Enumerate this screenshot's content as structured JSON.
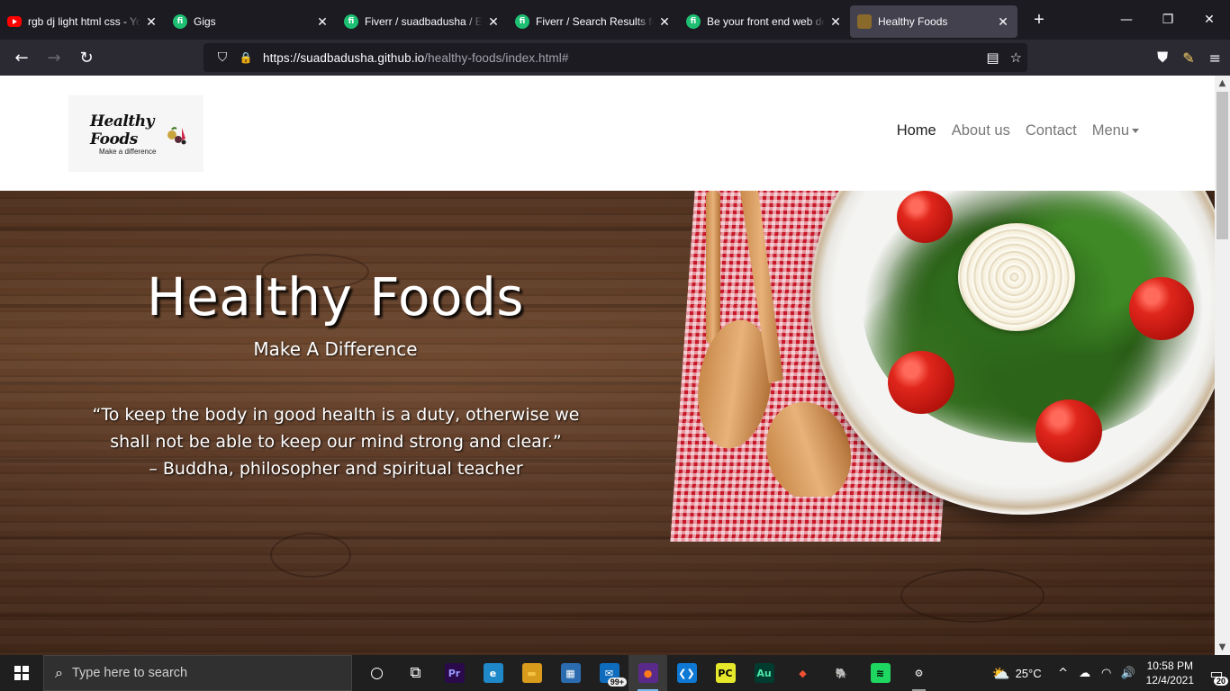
{
  "browser": {
    "tabs": [
      {
        "title": "rgb dj light html css - YouTube",
        "icon": "youtube-icon",
        "close": "✕"
      },
      {
        "title": "Gigs",
        "icon": "fiverr-icon",
        "close": "✕"
      },
      {
        "title": "Fiverr / suadbadusha / Edit Gig",
        "icon": "fiverr-icon",
        "close": "✕"
      },
      {
        "title": "Fiverr / Search Results for",
        "icon": "fiverr-icon",
        "close": "✕"
      },
      {
        "title": "Be your front end web developer",
        "icon": "fiverr-icon",
        "close": "✕"
      },
      {
        "title": "Healthy Foods",
        "icon": "healthy-foods-favicon",
        "close": "✕",
        "active": true
      }
    ],
    "new_tab": "+",
    "window_controls": {
      "minimize": "—",
      "restore": "❐",
      "close": "✕"
    },
    "nav": {
      "back": "←",
      "forward": "→",
      "reload": "↻"
    },
    "url": {
      "host": "https://suadbadusha.github.io",
      "path": "/healthy-foods/index.html#"
    },
    "url_icons": {
      "shield": "⛉",
      "lock": "🔒",
      "reader": "▤",
      "bookmark": "☆"
    },
    "toolbar_icons": {
      "pocket": "⛊",
      "pen": "✎",
      "menu": "≡"
    }
  },
  "site": {
    "logo": {
      "line1": "Healthy Foods",
      "line2": "Make a difference"
    },
    "menu": [
      {
        "label": "Home",
        "active": true
      },
      {
        "label": "About us"
      },
      {
        "label": "Contact"
      },
      {
        "label": "Menu",
        "dropdown": true
      }
    ],
    "hero": {
      "title": "Healthy Foods",
      "subtitle": "Make A Difference",
      "quote": "“To keep the body in good health is a duty, otherwise we shall not be able to keep our mind strong and clear.”",
      "attribution": "– Buddha, philosopher and spiritual teacher"
    }
  },
  "taskbar": {
    "search_placeholder": "Type here to search",
    "apps": [
      {
        "name": "cortana-icon",
        "label": "○"
      },
      {
        "name": "task-view-icon",
        "label": "⧉"
      },
      {
        "name": "premiere-pro-icon",
        "label": "Pr",
        "color": "#9999ff",
        "bg": "#2a0a4a"
      },
      {
        "name": "edge-icon",
        "label": "e",
        "color": "#ffffff",
        "bg": "#1e88c9"
      },
      {
        "name": "file-explorer-icon",
        "label": "▬",
        "color": "#f5c242",
        "bg": "#d99b1c"
      },
      {
        "name": "microsoft-store-icon",
        "label": "▦",
        "color": "#ffffff",
        "bg": "#2b6cb0"
      },
      {
        "name": "mail-icon",
        "label": "✉",
        "color": "#ffffff",
        "bg": "#0f6cbd",
        "badge": "99+"
      },
      {
        "name": "firefox-icon",
        "label": "●",
        "color": "#ff7a1a",
        "bg": "#5a2a8a",
        "active": true
      },
      {
        "name": "vscode-icon",
        "label": "❮❯",
        "color": "#ffffff",
        "bg": "#0e78d5"
      },
      {
        "name": "pycharm-icon",
        "label": "PC",
        "color": "#000000",
        "bg": "#e5e82a"
      },
      {
        "name": "audition-icon",
        "label": "Au",
        "color": "#4de8a8",
        "bg": "#003b2f"
      },
      {
        "name": "git-icon",
        "label": "◆",
        "color": "#f05033",
        "bg": "transparent"
      },
      {
        "name": "postgres-icon",
        "label": "🐘",
        "color": "#8fb4e0",
        "bg": "transparent"
      },
      {
        "name": "spotify-icon",
        "label": "≋",
        "color": "#000000",
        "bg": "#1ed760"
      },
      {
        "name": "settings-icon",
        "label": "⚙",
        "color": "#ffffff",
        "bg": "transparent",
        "running": true
      }
    ],
    "weather": {
      "icon": "⛅",
      "temp": "25°C"
    },
    "tray": {
      "chevron": "^",
      "cloud": "☁",
      "wifi": "◠",
      "volume": "🔊"
    },
    "time": "10:58 PM",
    "date": "12/4/2021",
    "notifications": "20"
  }
}
